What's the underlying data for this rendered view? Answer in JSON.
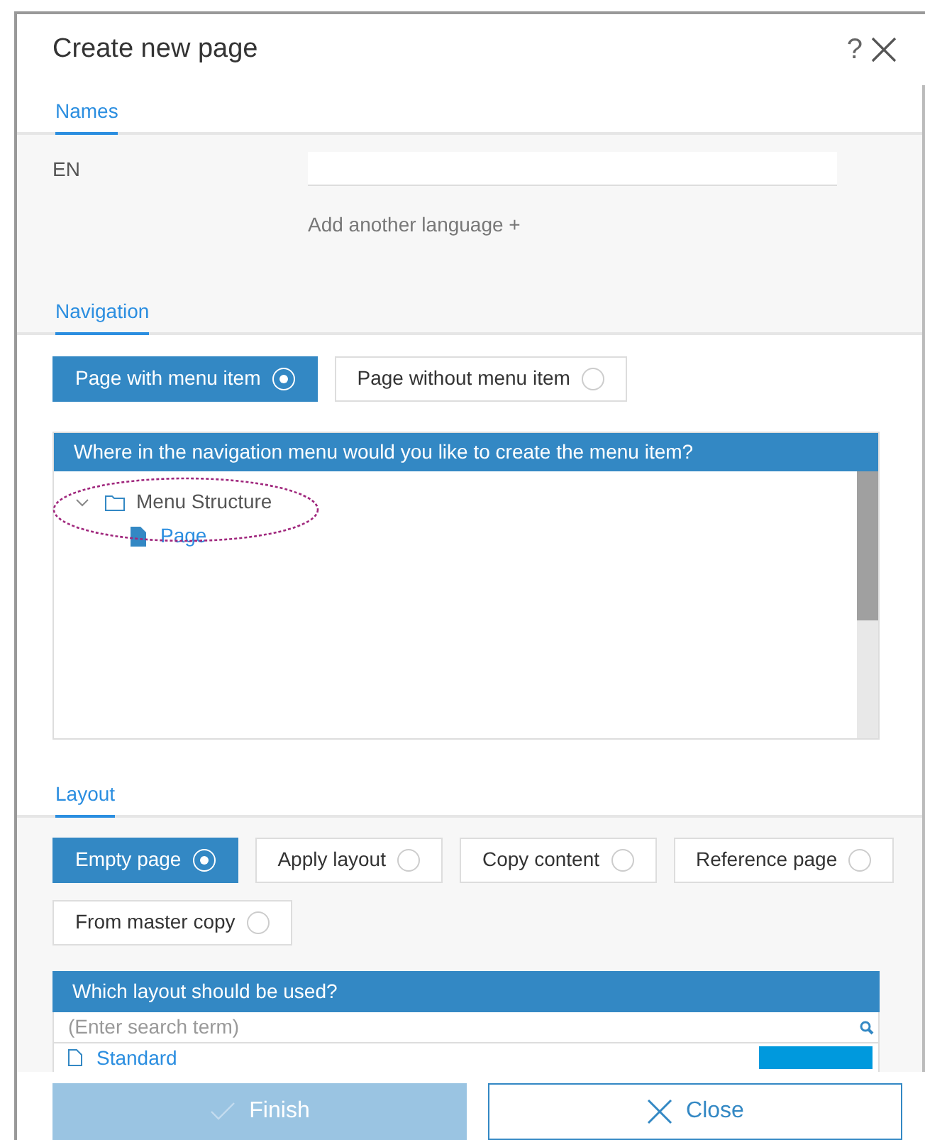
{
  "dialog": {
    "title": "Create new page",
    "help": "?"
  },
  "names": {
    "tab": {
      "label": "Names",
      "selected": true
    },
    "language": "EN",
    "add_language": "Add another language +"
  },
  "navigation": {
    "tab": {
      "label": "Navigation",
      "selected": true
    },
    "options": [
      {
        "label": "Page with menu item",
        "selected": true
      },
      {
        "label": "Page without menu item",
        "selected": false
      }
    ],
    "panel_title": "Where in the navigation menu would you like to create the menu item?",
    "tree": [
      {
        "label": "Menu Structure",
        "kind": "folder",
        "expanded": true,
        "children": [
          {
            "label": "Page",
            "kind": "page"
          }
        ]
      }
    ]
  },
  "layout": {
    "tab": {
      "label": "Layout",
      "selected": true
    },
    "options": [
      {
        "label": "Empty page",
        "selected": true
      },
      {
        "label": "Apply layout",
        "selected": false
      },
      {
        "label": "Copy content",
        "selected": false
      },
      {
        "label": "Reference page",
        "selected": false
      },
      {
        "label": "From master copy",
        "selected": false
      }
    ],
    "panel_title": "Which layout should be used?",
    "search": {
      "placeholder": "(Enter search term)"
    },
    "items": [
      {
        "label": "Standard",
        "selected": true
      }
    ]
  },
  "buttons": [
    {
      "label": "Finish",
      "kind": "primary",
      "disabled": true
    },
    {
      "label": "Close",
      "kind": "secondary",
      "disabled": false
    }
  ]
}
